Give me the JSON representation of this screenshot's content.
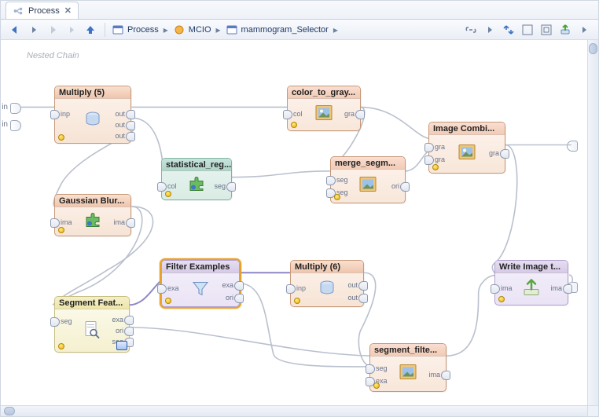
{
  "tab": {
    "title": "Process"
  },
  "breadcrumb": {
    "segments": [
      "Process",
      "MCIO",
      "mammogram_Selector"
    ]
  },
  "group": {
    "label": "Nested Chain"
  },
  "edge_ports": {
    "left": [
      {
        "label": "in"
      },
      {
        "label": "in"
      }
    ],
    "right": [
      {
        "label": ""
      }
    ]
  },
  "nodes": {
    "multiply5": {
      "title": "Multiply (5)",
      "in": [
        "inp"
      ],
      "out": [
        "out",
        "out",
        "out"
      ],
      "theme": "peach"
    },
    "colortogray": {
      "title": "color_to_gray...",
      "in": [
        "col"
      ],
      "out": [
        "gra"
      ],
      "theme": "peach-l"
    },
    "imagecomb": {
      "title": "Image Combi...",
      "in": [
        "gra",
        "gra"
      ],
      "out": [
        "gra"
      ],
      "theme": "peach-l"
    },
    "statreg": {
      "title": "statistical_reg...",
      "in": [
        "col"
      ],
      "out": [
        "seg"
      ],
      "theme": "teal"
    },
    "mergeseg": {
      "title": "merge_segm...",
      "in": [
        "seg",
        "seg"
      ],
      "out": [
        "ori"
      ],
      "theme": "peach-l"
    },
    "gblur": {
      "title": "Gaussian Blur...",
      "in": [
        "ima"
      ],
      "out": [
        "ima"
      ],
      "theme": "peach"
    },
    "segfeat": {
      "title": "Segment Feat...",
      "in": [
        "seg"
      ],
      "out": [
        "exa",
        "ori",
        "seg"
      ],
      "theme": "cream"
    },
    "filterex": {
      "title": "Filter Examples",
      "in": [
        "exa"
      ],
      "out": [
        "exa",
        "ori"
      ],
      "theme": "lav",
      "selected": true
    },
    "multiply6": {
      "title": "Multiply (6)",
      "in": [
        "inp"
      ],
      "out": [
        "out",
        "out"
      ],
      "theme": "peach"
    },
    "segfilt": {
      "title": "segment_filte...",
      "in": [
        "seg",
        "exa"
      ],
      "out": [
        "ima"
      ],
      "theme": "peach-l"
    },
    "writeimg": {
      "title": "Write Image t...",
      "in": [
        "ima"
      ],
      "out": [
        "ima"
      ],
      "theme": "lav"
    }
  }
}
